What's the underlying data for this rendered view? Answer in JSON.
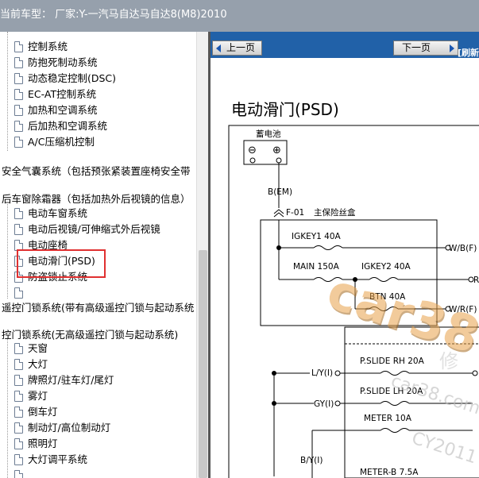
{
  "title_bar": {
    "text": "当前车型： 厂家:Y-一汽马自达马自达8(M8)2010"
  },
  "tree": {
    "items_group1": [
      "控制系统",
      "防抱死制动系统",
      "动态稳定控制(DSC)",
      "EC-AT控制系统",
      "加热和空调系统",
      "后加热和空调系统",
      "A/C压缩机控制"
    ],
    "section1": "安全气囊系统（包括预张紧装置座椅安全带",
    "section2": "后车窗除霜器（包括加热外后视镜的信息）",
    "items_group2": [
      "电动车窗系统",
      "电动后视镜/可伸缩式外后视镜",
      "电动座椅",
      "电动滑门(PSD)",
      "防盗锁止系统",
      ""
    ],
    "section3": "遥控门锁系统(带有高级遥控门锁与起动系统",
    "section4": "控门锁系统(无高级遥控门锁与起动系统)",
    "items_group3": [
      "天窗",
      "大灯",
      "牌照灯/驻车灯/尾灯",
      "雾灯",
      "倒车灯",
      "制动灯/高位制动灯",
      "照明灯",
      "大灯调平系统",
      ""
    ],
    "selected": "电动滑门(PSD)"
  },
  "toolbar": {
    "prev_label": "上一页",
    "next_label": "下一页",
    "refresh_label": "[刷新"
  },
  "document": {
    "title": "电动滑门(PSD)",
    "battery_label": "蓄电池",
    "minus": "⊖",
    "plus": "⊕",
    "wire_bem": "B(EM)",
    "fuse_box_id": "F-01",
    "fuse_box_label": "主保险丝盒",
    "fuses": [
      "IGKEY1 40A",
      "MAIN 150A",
      "IGKEY2 40A",
      "BTN 40A",
      "P.SLIDE RH 20A",
      "P.SLIDE LH 20A",
      "METER 10A",
      "METER-B 7.5A"
    ],
    "wires": [
      "W/B(F)",
      "R",
      "W/R(F)",
      "L/Y(I)",
      "GY(I)",
      "B/Y(I)",
      "B(I)"
    ],
    "watermark": "car38",
    "watermark2": "car38.com",
    "watermark3": "CY2011",
    "watermark4": "修"
  },
  "colors": {
    "title_bar": "#96a0ac",
    "toolbar": "#2161a8",
    "highlight": "#e03030",
    "watermark": "#e8a24a"
  }
}
